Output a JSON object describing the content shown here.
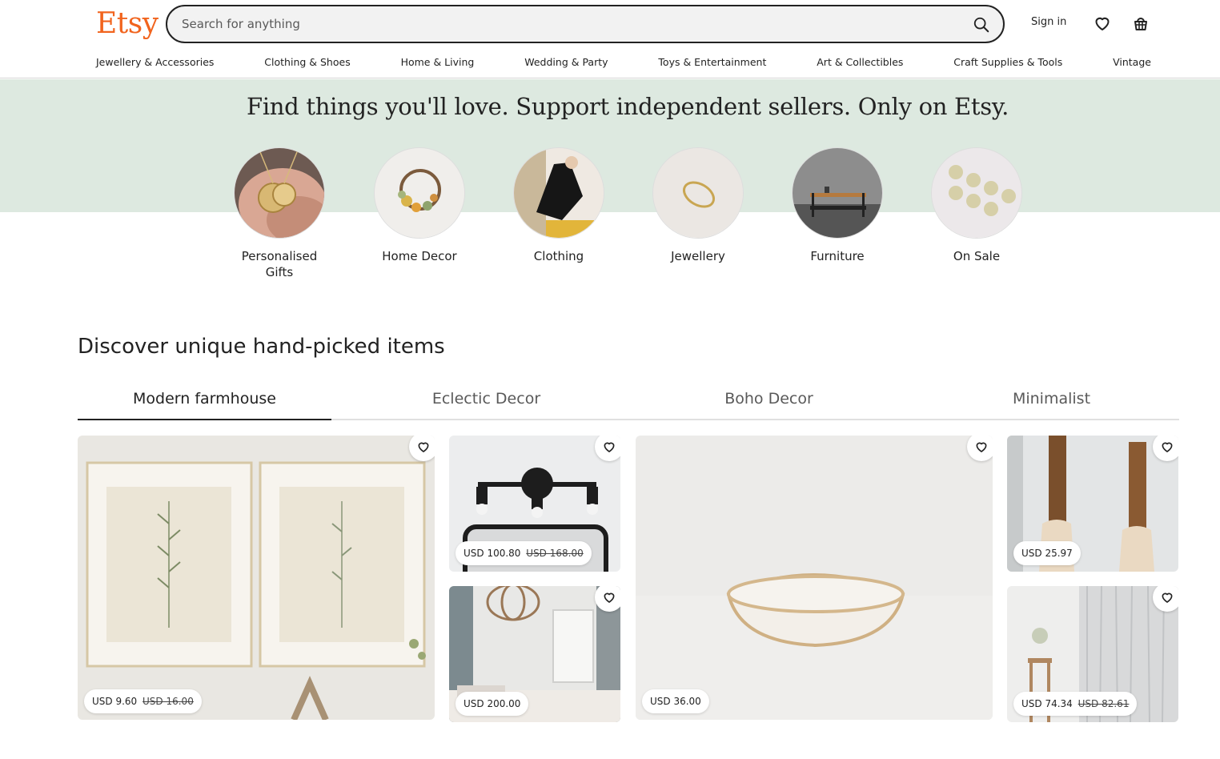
{
  "header": {
    "logo": "Etsy",
    "search_placeholder": "Search for anything",
    "signin_label": "Sign in"
  },
  "nav": [
    "Jewellery & Accessories",
    "Clothing & Shoes",
    "Home & Living",
    "Wedding & Party",
    "Toys & Entertainment",
    "Art & Collectibles",
    "Craft Supplies & Tools",
    "Vintage"
  ],
  "hero": {
    "title": "Find things you'll love. Support independent sellers. Only on Etsy."
  },
  "categories": [
    {
      "label": "Personalised Gifts",
      "icon": "pendant-photo"
    },
    {
      "label": "Home Decor",
      "icon": "wreath-photo"
    },
    {
      "label": "Clothing",
      "icon": "dress-photo"
    },
    {
      "label": "Jewellery",
      "icon": "ring-photo"
    },
    {
      "label": "Furniture",
      "icon": "table-photo"
    },
    {
      "label": "On Sale",
      "icon": "stickers-photo"
    }
  ],
  "discover": {
    "title": "Discover unique hand-picked items",
    "tabs": [
      "Modern farmhouse",
      "Eclectic Decor",
      "Boho Decor",
      "Minimalist"
    ],
    "active_tab": "Modern farmhouse"
  },
  "products": [
    {
      "name": "botanical-prints",
      "price": "USD 9.60",
      "original_price": "USD 16.00"
    },
    {
      "name": "wall-sconce",
      "price": "USD 100.80",
      "original_price": "USD 168.00"
    },
    {
      "name": "wood-chandelier",
      "price": "USD 200.00",
      "original_price": ""
    },
    {
      "name": "ceramic-bowl",
      "price": "USD 36.00",
      "original_price": ""
    },
    {
      "name": "wood-towel-hooks",
      "price": "USD 25.97",
      "original_price": ""
    },
    {
      "name": "linen-curtains",
      "price": "USD 74.34",
      "original_price": "USD 82.61"
    }
  ],
  "colors": {
    "brand": "#f1641e",
    "hero_band": "#dde9e0",
    "text": "#222222"
  }
}
